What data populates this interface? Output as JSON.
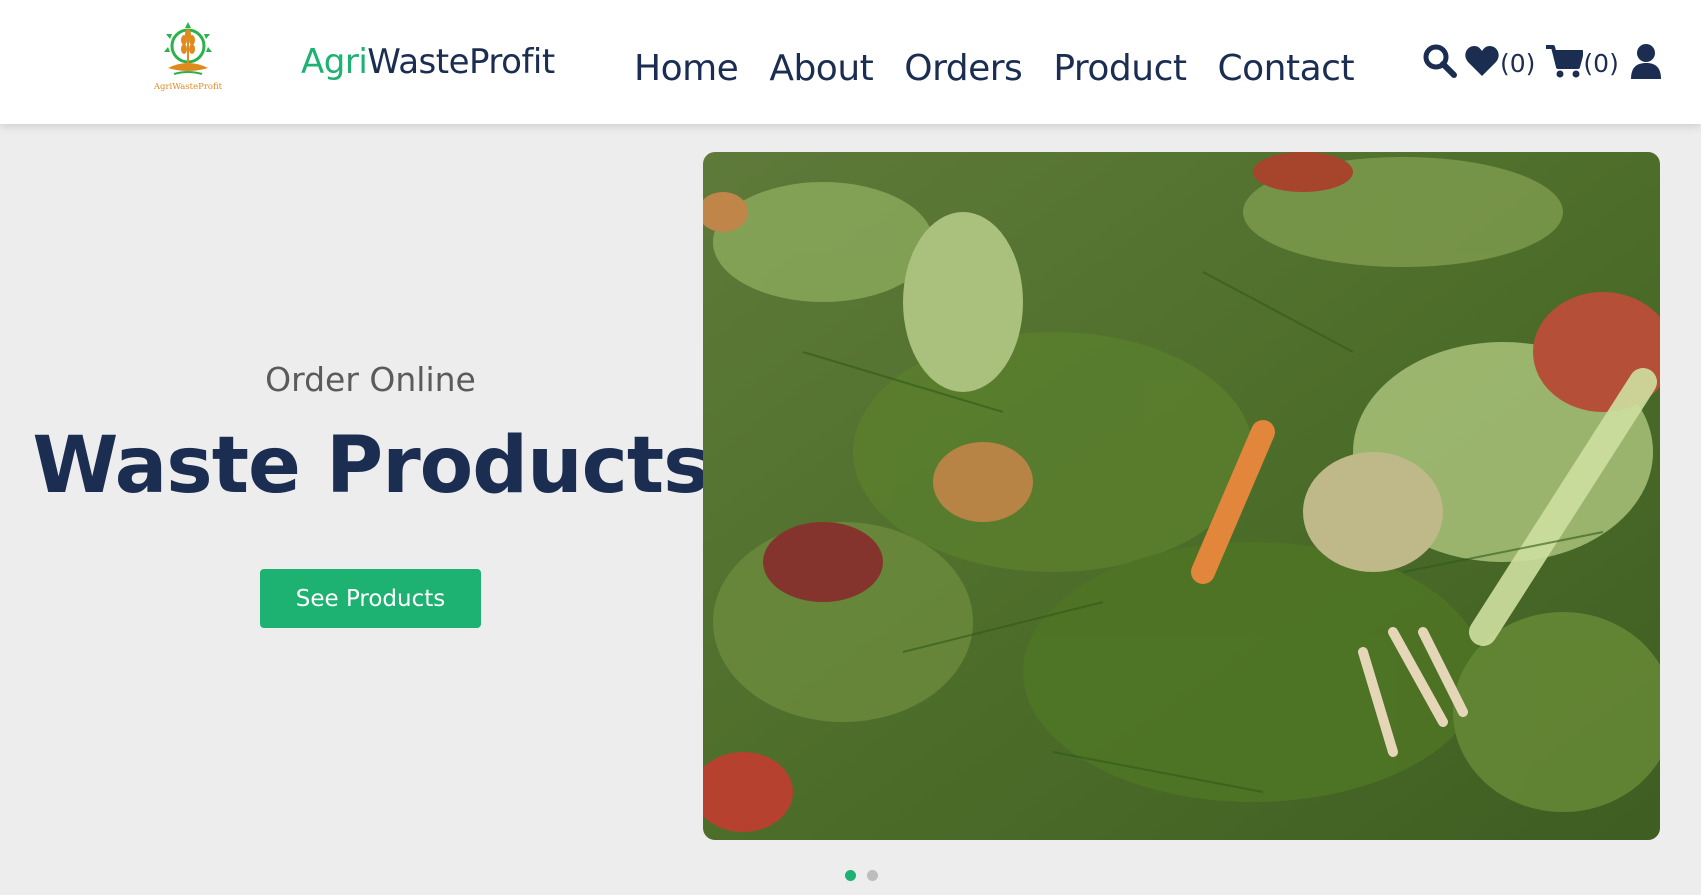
{
  "brand": {
    "prefix": "Agri",
    "suffix": "WasteProfit",
    "logo_caption": "AgriWasteProfit"
  },
  "nav": {
    "items": [
      "Home",
      "About",
      "Orders",
      "Product",
      "Contact"
    ]
  },
  "icons": {
    "search": "search-icon",
    "wishlist": "heart-icon",
    "cart": "cart-icon",
    "user": "user-icon"
  },
  "counts": {
    "wishlist": "(0)",
    "cart": "(0)"
  },
  "hero": {
    "subtitle": "Order Online",
    "title": "Waste Products",
    "button_label": "See Products",
    "image_alt": "agricultural waste image"
  },
  "carousel": {
    "slides": 2,
    "active": 1
  },
  "colors": {
    "accent": "#1db271",
    "navy": "#1b2e52",
    "background": "#ededed",
    "dot_inactive": "#bdbdbd"
  }
}
